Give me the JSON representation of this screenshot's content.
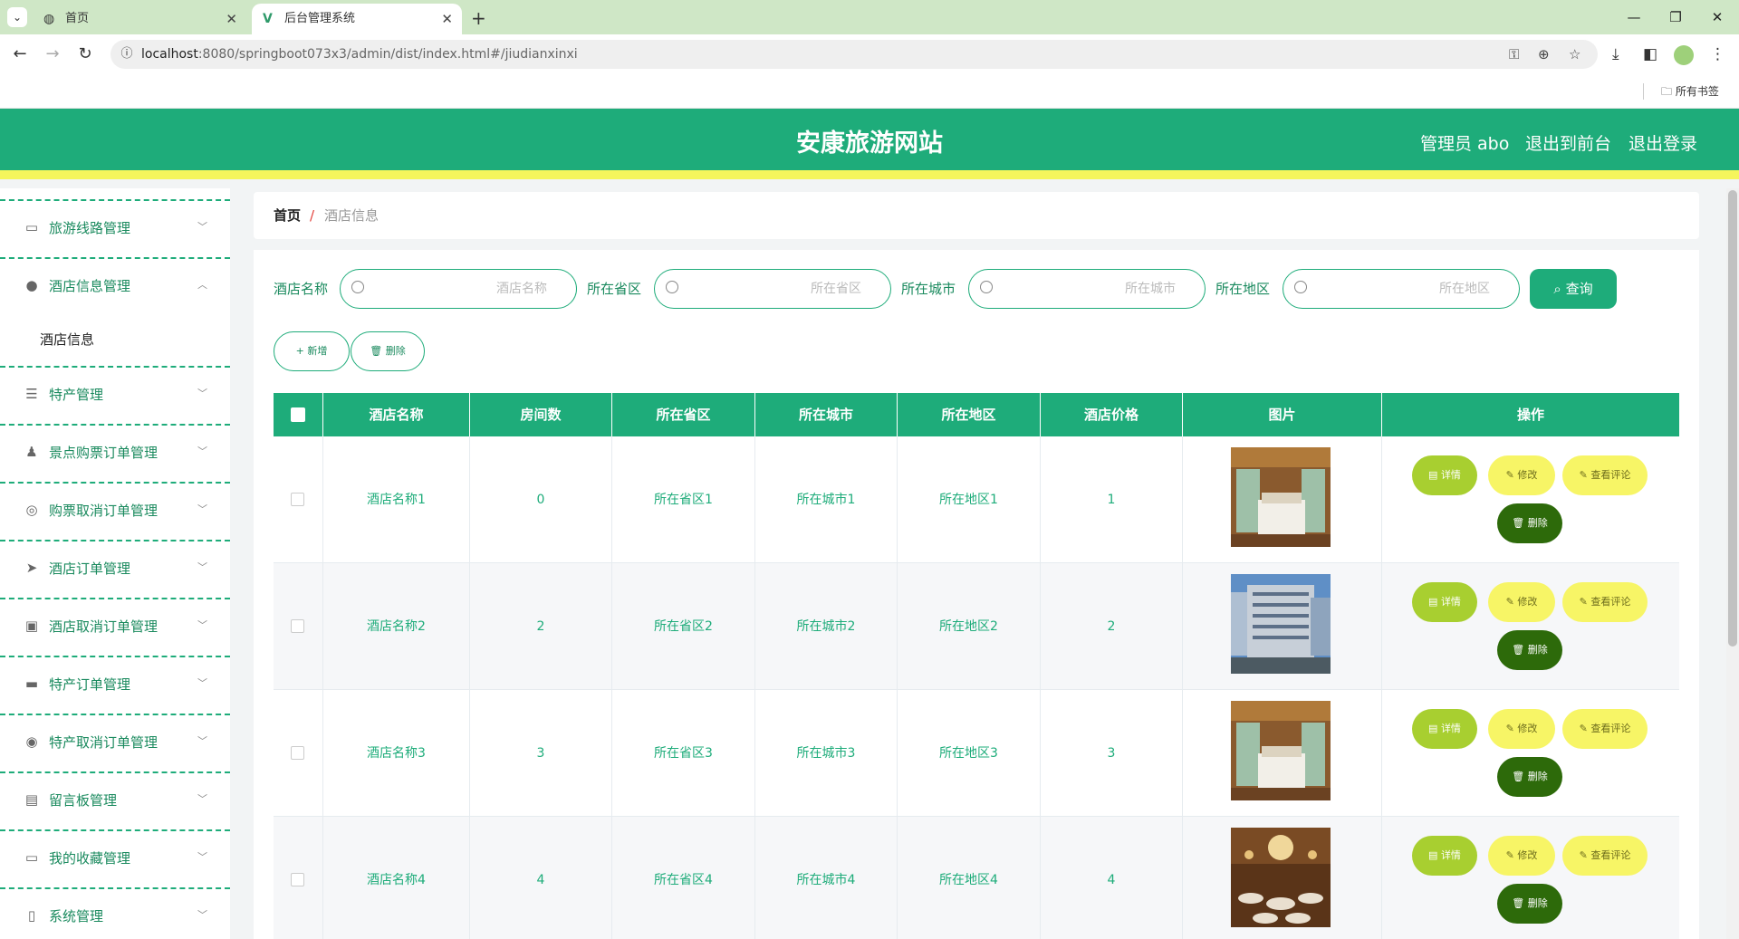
{
  "browser": {
    "tabs": [
      {
        "title": "首页",
        "icon": "globe-icon"
      },
      {
        "title": "后台管理系统",
        "icon": "vue-logo-icon"
      }
    ],
    "url_host": "localhost",
    "url_path": ":8080/springboot073x3/admin/dist/index.html#/jiudianxinxi",
    "bookmarks_label": "所有书签"
  },
  "header": {
    "site_title": "安康旅游网站",
    "user_label": "管理员 abo",
    "to_front_label": "退出到前台",
    "logout_label": "退出登录"
  },
  "sidebar": {
    "items": [
      {
        "label": "旅游线路管理",
        "icon": "message-icon"
      },
      {
        "label": "酒店信息管理",
        "icon": "location-pin-icon",
        "expanded": true
      },
      {
        "label": "特产管理",
        "icon": "sliders-icon"
      },
      {
        "label": "景点购票订单管理",
        "icon": "user-icon"
      },
      {
        "label": "购票取消订单管理",
        "icon": "compass-icon"
      },
      {
        "label": "酒店订单管理",
        "icon": "send-icon"
      },
      {
        "label": "酒店取消订单管理",
        "icon": "clipboard-icon"
      },
      {
        "label": "特产订单管理",
        "icon": "monitor-icon"
      },
      {
        "label": "特产取消订单管理",
        "icon": "help-circle-icon"
      },
      {
        "label": "留言板管理",
        "icon": "notebook-icon"
      },
      {
        "label": "我的收藏管理",
        "icon": "wallet-icon"
      },
      {
        "label": "系统管理",
        "icon": "phone-icon"
      }
    ],
    "active_sub": "酒店信息"
  },
  "breadcrumb": {
    "home": "首页",
    "separator": "/",
    "current": "酒店信息"
  },
  "filters": {
    "fields": [
      {
        "label": "酒店名称",
        "placeholder": "酒店名称"
      },
      {
        "label": "所在省区",
        "placeholder": "所在省区"
      },
      {
        "label": "所在城市",
        "placeholder": "所在城市"
      },
      {
        "label": "所在地区",
        "placeholder": "所在地区"
      }
    ],
    "query_label": "查询"
  },
  "actions": {
    "add_label": "新增",
    "delete_label": "删除"
  },
  "table": {
    "columns": [
      "酒店名称",
      "房间数",
      "所在省区",
      "所在城市",
      "所在地区",
      "酒店价格",
      "图片",
      "操作"
    ],
    "rows": [
      {
        "name": "酒店名称1",
        "rooms": "0",
        "province": "所在省区1",
        "city": "所在城市1",
        "district": "所在地区1",
        "price": "1",
        "image": "hotel-room"
      },
      {
        "name": "酒店名称2",
        "rooms": "2",
        "province": "所在省区2",
        "city": "所在城市2",
        "district": "所在地区2",
        "price": "2",
        "image": "hotel-building"
      },
      {
        "name": "酒店名称3",
        "rooms": "3",
        "province": "所在省区3",
        "city": "所在城市3",
        "district": "所在地区3",
        "price": "3",
        "image": "hotel-room"
      },
      {
        "name": "酒店名称4",
        "rooms": "4",
        "province": "所在省区4",
        "city": "所在城市4",
        "district": "所在地区4",
        "price": "4",
        "image": "banquet-hall"
      }
    ],
    "row_actions": {
      "detail": "详情",
      "edit": "修改",
      "reviews": "查看评论",
      "delete": "删除"
    }
  },
  "colors": {
    "primary": "#1eac7a",
    "accent_yellow": "#f5f55c",
    "detail_button": "#a8cf30",
    "delete_button": "#2d6a0a"
  }
}
